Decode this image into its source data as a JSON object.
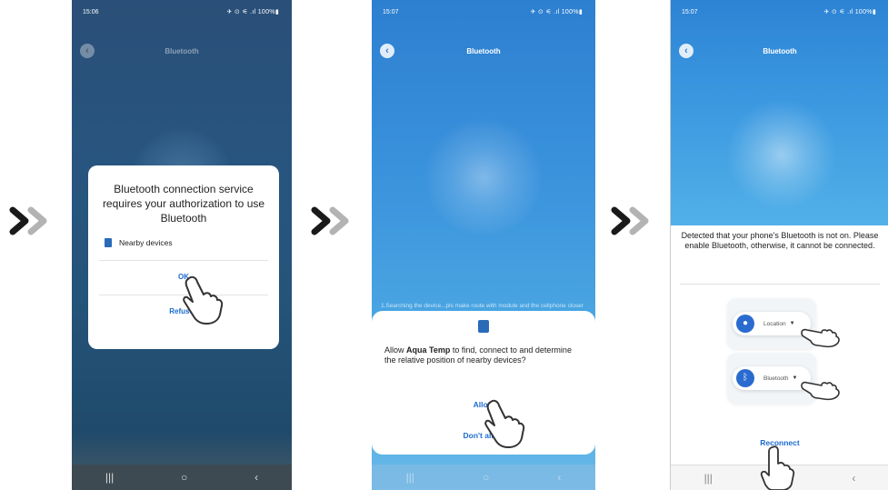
{
  "colors": {
    "accent": "#1a6bd0",
    "dark_chevron": "#1a1a1a",
    "light_chevron": "#b3b3b3"
  },
  "phone1": {
    "status_time": "15:06",
    "status_right": "✈ ⊙ ⚟ .ıl 100%▮",
    "app_title": "Bluetooth",
    "dialog": {
      "title": "Bluetooth connection service requires your authorization to use Bluetooth",
      "permission_label": "Nearby devices",
      "ok_label": "OK",
      "refuse_label": "Refused"
    },
    "nav": {
      "recent": "|||",
      "home": "○",
      "back": "‹"
    }
  },
  "phone2": {
    "status_time": "15:07",
    "status_right": "✈ ⊙ ⚟ .ıl 100%▮",
    "app_title": "Bluetooth",
    "hint": "1.Searching the device...pls make route with module and the cellphone closer",
    "sheet": {
      "msg_prefix": "Allow ",
      "app_name": "Aqua Temp",
      "msg_suffix": " to find, connect to and determine the relative position of nearby devices?",
      "allow_label": "Allow",
      "dont_allow_label": "Don't allow"
    },
    "nav": {
      "recent": "|||",
      "home": "○",
      "back": "‹"
    }
  },
  "phone3": {
    "status_time": "15:07",
    "status_right": "✈ ⊙ ⚟ .ıl 100%▮",
    "app_title": "Bluetooth",
    "message": "Detected that your phone's Bluetooth is not on. Please enable Bluetooth, otherwise, it cannot be connected.",
    "location_label": "Location",
    "bluetooth_label": "Bluetooth",
    "reconnect_label": "Reconnect",
    "nav": {
      "recent": "|||",
      "home": "○",
      "back": "‹"
    }
  }
}
